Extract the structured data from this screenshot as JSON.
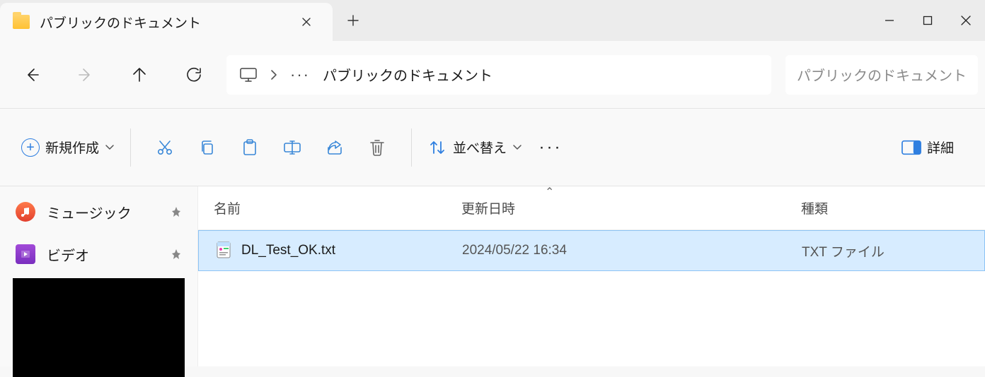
{
  "tab": {
    "title": "パブリックのドキュメント"
  },
  "breadcrumb": {
    "current": "パブリックのドキュメント"
  },
  "search": {
    "placeholder": "パブリックのドキュメント"
  },
  "toolbar": {
    "new_label": "新規作成",
    "sort_label": "並べ替え",
    "details_label": "詳細"
  },
  "columns": {
    "name": "名前",
    "date": "更新日時",
    "type": "種類"
  },
  "sidebar": {
    "items": [
      {
        "label": "ミュージック"
      },
      {
        "label": "ビデオ"
      }
    ]
  },
  "files": [
    {
      "name": "DL_Test_OK.txt",
      "date": "2024/05/22 16:34",
      "type": "TXT ファイル"
    }
  ]
}
